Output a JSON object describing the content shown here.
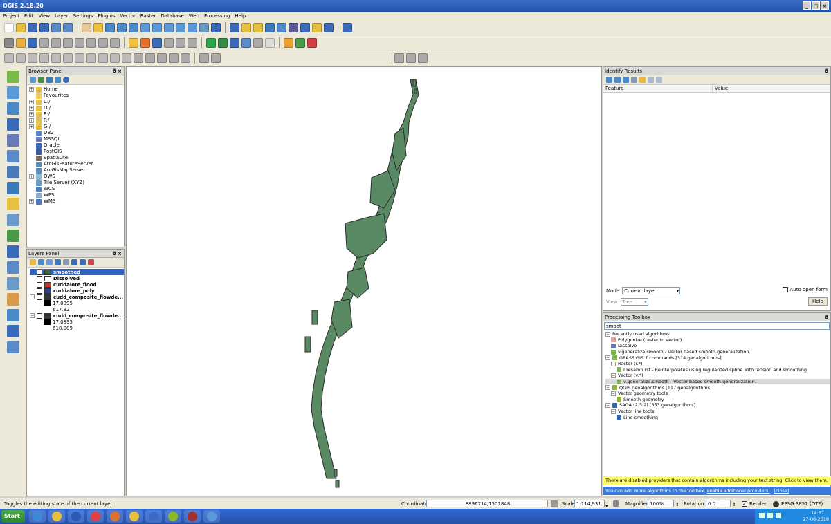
{
  "window": {
    "title": "QGIS 2.18.20",
    "controls": [
      "_",
      "□",
      "×"
    ]
  },
  "menu": [
    "Project",
    "Edit",
    "View",
    "Layer",
    "Settings",
    "Plugins",
    "Vector",
    "Raster",
    "Database",
    "Web",
    "Processing",
    "Help"
  ],
  "browser": {
    "title": "Browser Panel",
    "items": [
      {
        "label": "Home",
        "expand": "+",
        "icon": "folder-icon",
        "color": "#e8c040"
      },
      {
        "label": "Favourites",
        "expand": "",
        "icon": "star-icon",
        "color": "#f4d050"
      },
      {
        "label": "C:/",
        "expand": "+",
        "icon": "drive-icon",
        "color": "#e8c040"
      },
      {
        "label": "D:/",
        "expand": "+",
        "icon": "drive-icon",
        "color": "#e8c040"
      },
      {
        "label": "E:/",
        "expand": "+",
        "icon": "drive-icon",
        "color": "#e8c040"
      },
      {
        "label": "F:/",
        "expand": "+",
        "icon": "drive-icon",
        "color": "#e8c040"
      },
      {
        "label": "G:/",
        "expand": "+",
        "icon": "drive-icon",
        "color": "#e8c040"
      },
      {
        "label": "DB2",
        "expand": "",
        "icon": "db2-icon",
        "color": "#5a82c8"
      },
      {
        "label": "MSSQL",
        "expand": "",
        "icon": "mssql-icon",
        "color": "#6a7ab8"
      },
      {
        "label": "Oracle",
        "expand": "",
        "icon": "oracle-icon",
        "color": "#3a6ab8"
      },
      {
        "label": "PostGIS",
        "expand": "",
        "icon": "postgis-icon",
        "color": "#3a5a98"
      },
      {
        "label": "SpatiaLite",
        "expand": "",
        "icon": "spatialite-icon",
        "color": "#7a6a5a"
      },
      {
        "label": "ArcGisFeatureServer",
        "expand": "",
        "icon": "arcgis-icon",
        "color": "#5a8ab8"
      },
      {
        "label": "ArcGisMapServer",
        "expand": "",
        "icon": "arcgis-icon",
        "color": "#5a8ab8"
      },
      {
        "label": "OWS",
        "expand": "+",
        "icon": "ows-icon",
        "color": "#8ab8d8"
      },
      {
        "label": "Tile Server (XYZ)",
        "expand": "",
        "icon": "xyz-icon",
        "color": "#6a9ac8"
      },
      {
        "label": "WCS",
        "expand": "",
        "icon": "wcs-icon",
        "color": "#4a7ab8"
      },
      {
        "label": "WFS",
        "expand": "",
        "icon": "wfs-icon",
        "color": "#8aa8c8"
      },
      {
        "label": "WMS",
        "expand": "+",
        "icon": "wms-icon",
        "color": "#4a7ab8"
      }
    ]
  },
  "layers": {
    "title": "Layers Panel",
    "items": [
      {
        "label": "smoothed",
        "checked": true,
        "color": "#3a6a4a",
        "bold": true,
        "selected": true
      },
      {
        "label": "Dissolved",
        "checked": false,
        "color": "#ffffff",
        "bold": true
      },
      {
        "label": "cuddalore_flood",
        "checked": false,
        "color": "#c0392b",
        "bold": true
      },
      {
        "label": "cuddalore_poly",
        "checked": false,
        "color": "#2c3e9b",
        "bold": true
      },
      {
        "label": "cudd_composite_flowde...",
        "checked": false,
        "color": "#333333",
        "bold": true,
        "legend": [
          "17.0895",
          "617.32"
        ]
      },
      {
        "label": "cudd_composite_flowde...",
        "checked": false,
        "color": "#333333",
        "bold": true,
        "legend": [
          "17.0895",
          "618.009"
        ]
      }
    ]
  },
  "identify": {
    "title": "Identify Results",
    "columns": [
      "Feature",
      "Value"
    ],
    "mode_label": "Mode",
    "mode_value": "Current layer",
    "view_label": "View",
    "view_value": "Tree",
    "auto_open": "Auto open form",
    "help": "Help"
  },
  "processing": {
    "title": "Processing Toolbox",
    "search": "smoot",
    "tree": [
      {
        "indent": 0,
        "text": "Recently used algorithms",
        "expand": "-",
        "icon": "",
        "color": ""
      },
      {
        "indent": 1,
        "text": "Polygonize (raster to vector)",
        "expand": "",
        "icon": "polygonize-icon",
        "color": "#e0a0a0"
      },
      {
        "indent": 1,
        "text": "Dissolve",
        "expand": "",
        "icon": "dissolve-icon",
        "color": "#5a7ab8"
      },
      {
        "indent": 1,
        "text": "v.generalize.smooth - Vector based smooth generalization.",
        "expand": "",
        "icon": "grass-icon",
        "color": "#7ab84a"
      },
      {
        "indent": 0,
        "text": "GRASS GIS 7 commands [314 geoalgorithms]",
        "expand": "-",
        "icon": "grass-icon",
        "color": "#7ab84a"
      },
      {
        "indent": 1,
        "text": "Raster (r.*)",
        "expand": "-",
        "icon": "",
        "color": ""
      },
      {
        "indent": 2,
        "text": "r.resamp.rst - Reinterpolates using regularized spline with tension and smoothing.",
        "expand": "",
        "icon": "grass-icon",
        "color": "#7ab84a"
      },
      {
        "indent": 1,
        "text": "Vector (v.*)",
        "expand": "-",
        "icon": "",
        "color": ""
      },
      {
        "indent": 2,
        "text": "v.generalize.smooth - Vector based smooth generalization.",
        "expand": "",
        "icon": "grass-icon",
        "color": "#7ab84a",
        "highlight": true
      },
      {
        "indent": 0,
        "text": "QGIS geoalgorithms [117 geoalgorithms]",
        "expand": "-",
        "icon": "qgis-icon",
        "color": "#8ab82a"
      },
      {
        "indent": 1,
        "text": "Vector geometry tools",
        "expand": "-",
        "icon": "",
        "color": ""
      },
      {
        "indent": 2,
        "text": "Smooth geometry",
        "expand": "",
        "icon": "smooth-icon",
        "color": "#8ab82a"
      },
      {
        "indent": 0,
        "text": "SAGA (2.3.2) [353 geoalgorithms]",
        "expand": "-",
        "icon": "saga-icon",
        "color": "#2a6ab8"
      },
      {
        "indent": 1,
        "text": "Vector line tools",
        "expand": "-",
        "icon": "",
        "color": ""
      },
      {
        "indent": 2,
        "text": "Line smoothing",
        "expand": "",
        "icon": "saga-icon",
        "color": "#2a6ab8"
      }
    ],
    "banner_yellow": "There are disabled providers that contain algorithms including your text string. Click to view them.",
    "banner_blue_text": "You can add more algorithms to the toolbox,",
    "banner_blue_link": "enable additional providers.",
    "banner_blue_close": "[close]"
  },
  "status": {
    "message": "Toggles the editing state of the current layer",
    "coordinate_label": "Coordinate",
    "coordinate_value": "8896714,1301848",
    "scale_label": "Scale",
    "scale_value": "1:114,931",
    "magnifier_label": "Magnifier",
    "magnifier_value": "100%",
    "rotation_label": "Rotation",
    "rotation_value": "0.0",
    "render_label": "Render",
    "crs": "EPSG:3857 (OTF)"
  },
  "taskbar": {
    "start": "Start",
    "time": "14:57",
    "date": "27-06-2018",
    "apps": [
      {
        "name": "ie-icon",
        "color": "#3a8ad8"
      },
      {
        "name": "explorer-icon",
        "color": "#e8c040"
      },
      {
        "name": "teamviewer-icon",
        "color": "#2a5ab8"
      },
      {
        "name": "chrome-icon",
        "color": "#e04040"
      },
      {
        "name": "mail-icon",
        "color": "#e07030"
      },
      {
        "name": "folder-icon",
        "color": "#e8c040"
      },
      {
        "name": "word-icon",
        "color": "#3a6ac8"
      },
      {
        "name": "qgis-icon",
        "color": "#8ab82a"
      },
      {
        "name": "commit-icon",
        "color": "#a03030"
      },
      {
        "name": "window-icon",
        "color": "#5a9ad8"
      }
    ]
  },
  "map_fill": "#5a8a64",
  "map_stroke": "#2a2a2a"
}
